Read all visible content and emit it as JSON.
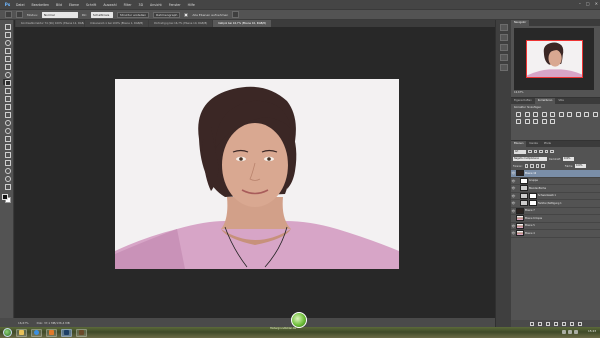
{
  "menubar": {
    "logo": "Ps",
    "items": [
      "Datei",
      "Bearbeiten",
      "Bild",
      "Ebene",
      "Schrift",
      "Auswahl",
      "Filter",
      "3D",
      "Ansicht",
      "Fenster",
      "Hilfe"
    ],
    "window_controls": [
      "–",
      "□",
      "✕"
    ]
  },
  "optbar": {
    "modus_label": "Modus:",
    "modus_value": "Normal",
    "deckkraft_label": "Dk:",
    "deckkraft_value": "Schaltkreis",
    "fluss_value": "Struktur erstellen",
    "ausrichten_value": "Rahmengraph",
    "sample_label": "Alle Ebenen aufnehmen"
  },
  "tabs": [
    {
      "label": "Kontrastkorrektur 74 (SK) 100% (Ebene 12, RGB/8)",
      "active": false
    },
    {
      "label": "Unbenannt-1 bei 100% (Ebene 1, RGB/8)",
      "active": false
    },
    {
      "label": "Portrait.jpg bei 16,7% (Ebene 10, RGB/8)",
      "active": false
    },
    {
      "label": "Katipol bei 16,7% (Ebene 10, RGB/8)",
      "active": true
    }
  ],
  "statusbar": {
    "zoom": "16,67%",
    "doc": "Dok: 37,1 MB/136,4 MB",
    "timeline": "Zeitleiste"
  },
  "navigator": {
    "tab": "Navigator",
    "zoom": "16,67%"
  },
  "adjustments": {
    "tabs": [
      "Eigenschaften",
      "Korrekturen",
      "Stile"
    ],
    "title": "Korrektur hinzufügen"
  },
  "layers": {
    "tabs": [
      "Ebenen",
      "Kanäle",
      "Pfade"
    ],
    "filter": "Art",
    "blend_mode": "Negativ multiplizieren",
    "opacity_label": "Deckkraft:",
    "opacity_value": "100%",
    "fill_label": "Fläche:",
    "fill_value": "100%",
    "lock_label": "Fixieren:",
    "items": [
      {
        "name": "Ebene 10",
        "thumb": "dark",
        "mask": false,
        "indent": false,
        "selected": true
      },
      {
        "name": "Gruppe",
        "thumb": "",
        "mask": true,
        "indent": true,
        "selected": false
      },
      {
        "name": "Blendenfläche",
        "thumb": "",
        "mask": false,
        "indent": true,
        "selected": false
      },
      {
        "name": "Schwarzweiß 1",
        "thumb": "",
        "mask": true,
        "indent": true,
        "selected": false
      },
      {
        "name": "Farbton/Sättigung 1",
        "thumb": "",
        "mask": true,
        "indent": true,
        "selected": false
      },
      {
        "name": "Ebene 7",
        "thumb": "dark",
        "mask": false,
        "indent": false,
        "selected": false
      },
      {
        "name": "Ebene 6 Kopie",
        "thumb": "photo",
        "mask": false,
        "indent": false,
        "selected": false
      },
      {
        "name": "Ebene 5",
        "thumb": "photo",
        "mask": false,
        "indent": false,
        "selected": false
      },
      {
        "name": "Ebene 4",
        "thumb": "photo",
        "mask": false,
        "indent": false,
        "selected": false
      }
    ]
  },
  "taskbar": {
    "clock": "15:23",
    "watermark": "Hintergrundbilder.de"
  },
  "colors": {
    "accent": "#7a8ea8",
    "canvas_bg": "#282828",
    "image_bg": "#f3f1f2"
  }
}
